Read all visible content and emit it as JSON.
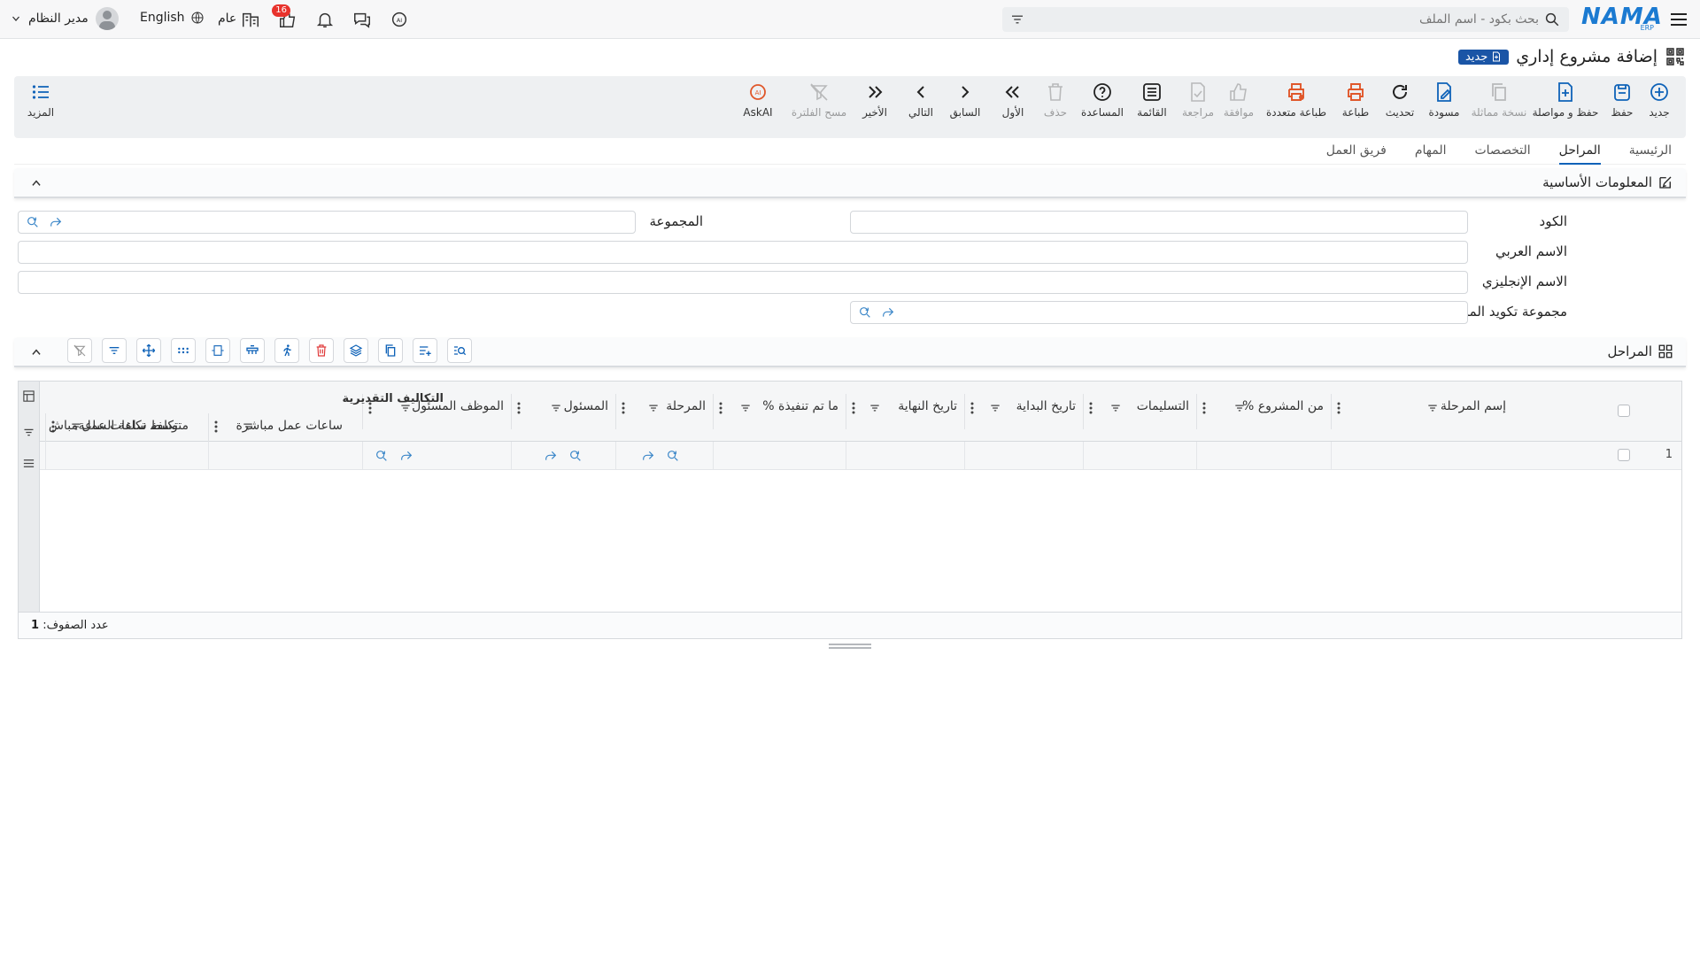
{
  "topbar": {
    "logo_text": "NAMA",
    "logo_sub": "ERP",
    "search_placeholder": "بحث بكود - اسم الملف",
    "notification_count": "16",
    "general_label": "عام",
    "language_label": "English",
    "user_name": "مدير النظام"
  },
  "page": {
    "title": "إضافة مشروع إداري",
    "status_tag": "جديد"
  },
  "toolbar": {
    "new": "جديد",
    "save": "حفظ",
    "save_continue": "حفظ و مواصلة",
    "copy": "نسخة مماثلة",
    "draft": "مسودة",
    "refresh": "تحديث",
    "print": "طباعة",
    "multi_print": "طباعة متعددة",
    "approve": "موافقة",
    "review": "مراجعة",
    "list": "القائمة",
    "help": "المساعدة",
    "delete": "حذف",
    "first": "الأول",
    "previous": "السابق",
    "next": "التالي",
    "last": "الأخير",
    "clear_filter": "مسح الفلترة",
    "ask_ai": "AskAI",
    "more": "المزيد"
  },
  "tabs": [
    "الرئيسية",
    "المراحل",
    "التخصصات",
    "المهام",
    "فريق العمل"
  ],
  "active_tab": "المراحل",
  "basic_info": {
    "title": "المعلومات الأساسية",
    "code_label": "الكود",
    "group_label": "المجموعة",
    "arabic_name_label": "الاسم العربي",
    "english_name_label": "الاسم الإنجليزي",
    "stage_coding_group_label": "مجموعة تكويد المراحل",
    "code_value": "",
    "group_value": "",
    "arabic_name_value": "",
    "english_name_value": "",
    "stage_coding_group_value": ""
  },
  "stages_section": {
    "title": "المراحل"
  },
  "grid": {
    "columns": [
      "إسم المرحلة",
      "% من المشروع",
      "التسليمات",
      "تاريخ البداية",
      "تاريخ النهاية",
      "% ما تم تنفيذة",
      "المرحلة",
      "المسئول",
      "الموظف المسئول"
    ],
    "group_header": "التكاليف التقديرية",
    "group_columns": [
      "ساعات عمل مباشرة",
      "متوسط تكلفة الساعة",
      "تكلفة ساعات عمل مباش"
    ],
    "rows": [
      {
        "num": "1"
      }
    ],
    "row_count_label": "عدد الصفوف:",
    "row_count": "1"
  }
}
